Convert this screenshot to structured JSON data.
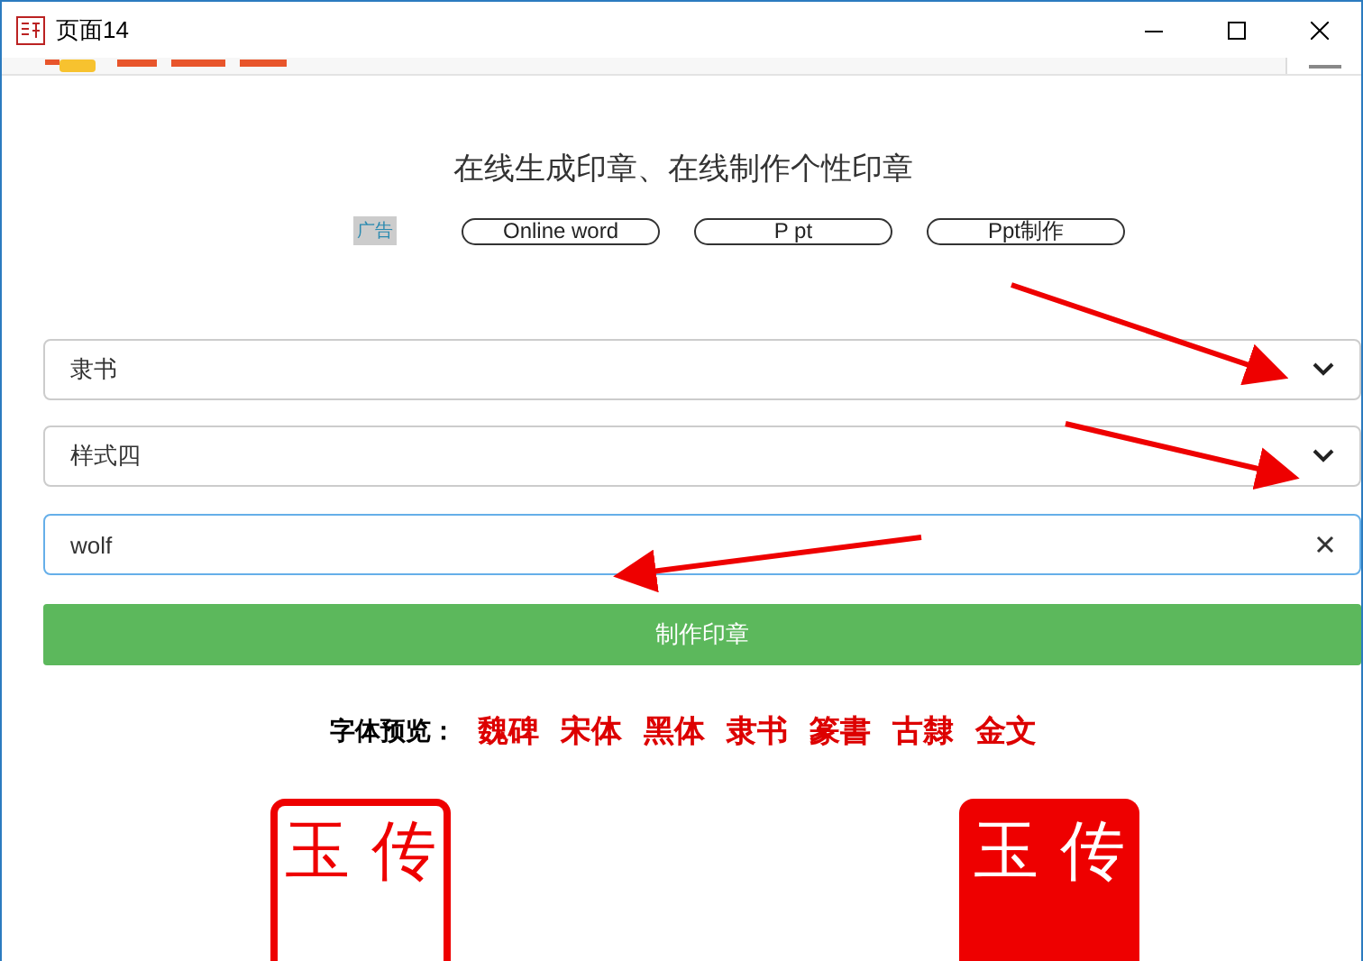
{
  "window": {
    "title": "页面14"
  },
  "heading": "在线生成印章、在线制作个性印章",
  "ad_label": "广告",
  "links": [
    "Online word",
    "P pt",
    "Ppt制作"
  ],
  "font_select": {
    "value": "隶书"
  },
  "style_select": {
    "value": "样式四"
  },
  "text_field": {
    "value": "wolf"
  },
  "submit_button": "制作印章",
  "font_preview": {
    "label": "字体预览：",
    "fonts": [
      "魏碑",
      "宋体",
      "黑体",
      "隶书",
      "篆書",
      "古隸",
      "金文"
    ]
  },
  "seals": [
    {
      "filled": false,
      "top_chars": [
        "玉",
        "传"
      ]
    },
    {
      "filled": true,
      "top_chars": [
        "玉",
        "传"
      ]
    }
  ],
  "annotations": [
    {
      "kind": "arrow"
    },
    {
      "kind": "arrow"
    },
    {
      "kind": "arrow"
    }
  ]
}
